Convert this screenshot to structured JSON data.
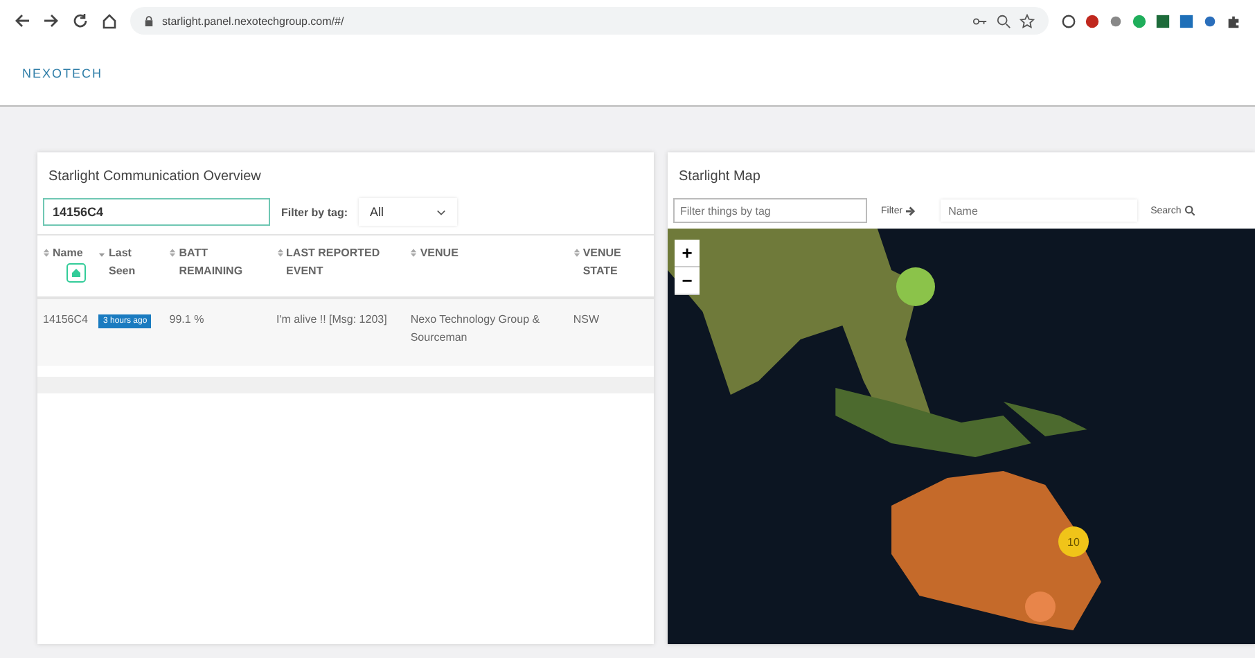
{
  "browser": {
    "url": "starlight.panel.nexotechgroup.com/#/"
  },
  "logo": "NEXOTECH",
  "overview": {
    "title": "Starlight Communication Overview",
    "search": {
      "value": "14156C4"
    },
    "filter_label": "Filter by tag:",
    "filter_value": "All",
    "columns": [
      {
        "label": "Name",
        "sorted": false
      },
      {
        "label": "Last Seen",
        "sorted": true
      },
      {
        "label": "BATT REMAINING",
        "sorted": false
      },
      {
        "label": "LAST REPORTED EVENT",
        "sorted": false
      },
      {
        "label": "VENUE",
        "sorted": false
      },
      {
        "label": "VENUE STATE",
        "sorted": false
      }
    ],
    "rows": [
      {
        "name": "14156C4",
        "last_seen": "3 hours ago",
        "batt": "99.1 %",
        "event": "I'm alive !! [Msg: 1203]",
        "venue": "Nexo Technology Group & Sourceman",
        "state": "NSW"
      }
    ]
  },
  "map": {
    "title": "Starlight Map",
    "tag_filter": {
      "placeholder": "Filter things by tag"
    },
    "filter_button": "Filter",
    "name_field": {
      "placeholder": "Name"
    },
    "search_button": "Search",
    "zoom_in": "+",
    "zoom_out": "−",
    "clusters": [
      {
        "color": "#8bc34a"
      },
      {
        "label": "10",
        "color": "#f0c419"
      },
      {
        "color": "#e8854a"
      }
    ]
  }
}
